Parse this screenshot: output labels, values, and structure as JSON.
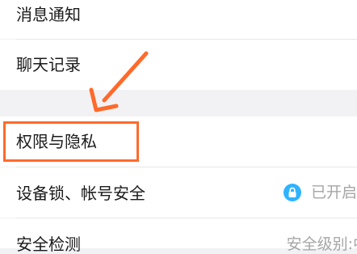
{
  "settings": {
    "rows": [
      {
        "label": "消息通知"
      },
      {
        "label": "聊天记录"
      },
      {
        "label": "权限与隐私"
      },
      {
        "label": "设备锁、帐号安全",
        "value": "已开启",
        "icon": "lock-icon"
      },
      {
        "label": "安全检测",
        "value": "安全级别:中"
      }
    ]
  },
  "colors": {
    "highlight": "#ff6a2b",
    "lock_badge": "#2fb3ff"
  },
  "annotation": {
    "arrow_color": "#ff6a2b"
  }
}
